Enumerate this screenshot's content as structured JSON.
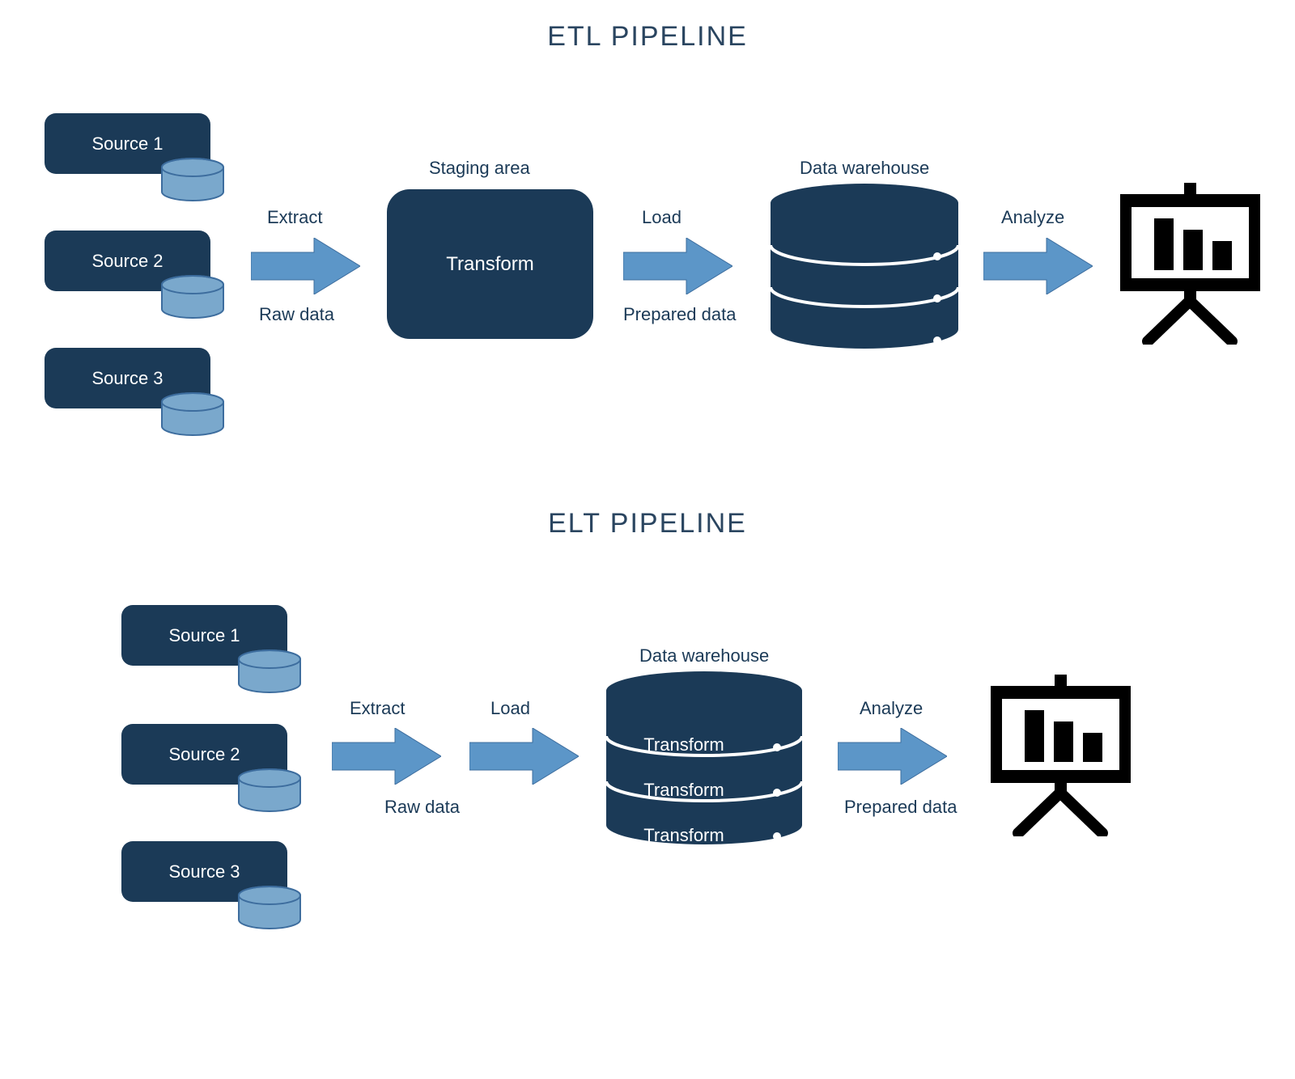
{
  "colors": {
    "dark_navy": "#1b3a57",
    "arrow_blue": "#5c96c8",
    "arrow_stroke": "#3d6d9e",
    "cyl_light": "#7aa8cc",
    "cyl_stroke": "#3d6d9e",
    "black": "#000000"
  },
  "etl": {
    "title": "ETL PIPELINE",
    "sources": [
      "Source 1",
      "Source 2",
      "Source 3"
    ],
    "arrow1_top": "Extract",
    "arrow1_bottom": "Raw data",
    "staging_title": "Staging area",
    "staging_box": "Transform",
    "arrow2_top": "Load",
    "arrow2_bottom": "Prepared data",
    "warehouse_title": "Data warehouse",
    "arrow3_top": "Analyze"
  },
  "elt": {
    "title": "ELT PIPELINE",
    "sources": [
      "Source 1",
      "Source 2",
      "Source 3"
    ],
    "arrow1_top": "Extract",
    "arrow1_bottom": "Raw data",
    "arrow2_top": "Load",
    "warehouse_title": "Data warehouse",
    "warehouse_rows": [
      "Transform",
      "Transform",
      "Transform"
    ],
    "arrow3_top": "Analyze",
    "arrow3_bottom": "Prepared data"
  }
}
